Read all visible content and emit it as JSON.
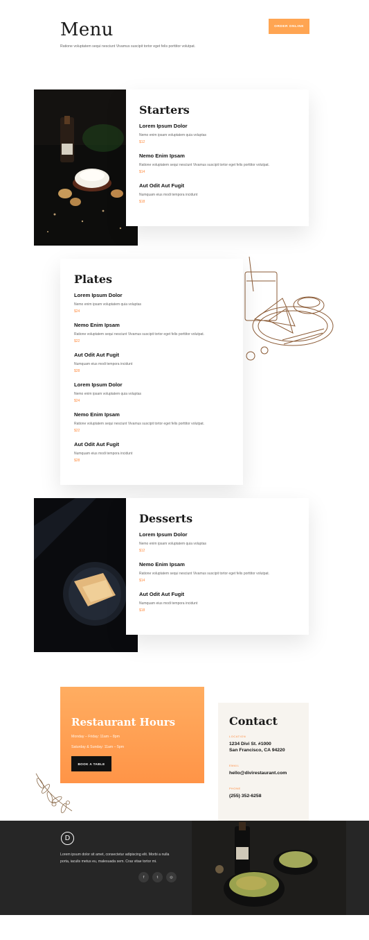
{
  "header": {
    "title": "Menu",
    "subtitle": "Ratione voluptatem sequi nesciunt Vivamus suscipit tortor eget felis porttitor volutpat.",
    "order_button": "ORDER ONLINE"
  },
  "starters": {
    "title": "Starters",
    "items": [
      {
        "name": "Lorem Ipsum Dolor",
        "desc": "Nemo enim ipsam voluptatem quia voluptas",
        "price": "$12"
      },
      {
        "name": "Nemo Enim Ipsam",
        "desc": "Ratione voluptatem sequi nesciunt Vivamus suscipit tortor eget felis porttitor volutpat.",
        "price": "$14"
      },
      {
        "name": "Aut Odit Aut Fugit",
        "desc": "Numquam eius modi tempora incidunt",
        "price": "$18"
      }
    ]
  },
  "plates": {
    "title": "Plates",
    "items": [
      {
        "name": "Lorem Ipsum Dolor",
        "desc": "Nemo enim ipsam voluptatem quia voluptas",
        "price": "$24"
      },
      {
        "name": "Nemo Enim Ipsam",
        "desc": "Ratione voluptatem sequi nesciunt Vivamus suscipit tortor eget felis porttitor volutpat.",
        "price": "$22"
      },
      {
        "name": "Aut Odit Aut Fugit",
        "desc": "Numquam eius modi tempora incidunt",
        "price": "$28"
      },
      {
        "name": "Lorem Ipsum Dolor",
        "desc": "Nemo enim ipsam voluptatem quia voluptas",
        "price": "$24"
      },
      {
        "name": "Nemo Enim Ipsam",
        "desc": "Ratione voluptatem sequi nesciunt Vivamus suscipit tortor eget felis porttitor volutpat.",
        "price": "$22"
      },
      {
        "name": "Aut Odit Aut Fugit",
        "desc": "Numquam eius modi tempora incidunt",
        "price": "$28"
      }
    ]
  },
  "desserts": {
    "title": "Desserts",
    "items": [
      {
        "name": "Lorem Ipsum Dolor",
        "desc": "Nemo enim ipsam voluptatem quia voluptas",
        "price": "$12"
      },
      {
        "name": "Nemo Enim Ipsam",
        "desc": "Ratione voluptatem sequi nesciunt Vivamus suscipit tortor eget felis porttitor volutpat.",
        "price": "$14"
      },
      {
        "name": "Aut Odit Aut Fugit",
        "desc": "Numquam eius modi tempora incidunt",
        "price": "$18"
      }
    ]
  },
  "hours": {
    "title": "Restaurant Hours",
    "weekday": "Monday – Friday: 11am – 8pm",
    "weekend": "Saturday & Sunday: 11am – 5pm",
    "book_button": "BOOK A TABLE"
  },
  "contact": {
    "title": "Contact",
    "location_label": "LOCATION",
    "address_line1": "1234 Divi St. #1000",
    "address_line2": "San Francisco, CA 94220",
    "email_label": "EMAIL",
    "email": "hello@divirestaurant.com",
    "phone_label": "PHONE",
    "phone": "(255) 352-6258"
  },
  "footer": {
    "logo_letter": "D",
    "text": "Lorem ipsum dolor sit amet, consectetur adipiscing elit. Morbi a nulla porta, iaculis metus eu, malesuada sem. Cras vitae tortor mi.",
    "social": [
      {
        "icon": "facebook-icon",
        "glyph": "f"
      },
      {
        "icon": "twitter-icon",
        "glyph": "t"
      },
      {
        "icon": "dribbble-icon",
        "glyph": "◎"
      }
    ]
  },
  "colors": {
    "accent": "#ffa552",
    "price": "#ff8a3d",
    "footer_bg": "#262626",
    "contact_bg": "#f7f4ef"
  }
}
